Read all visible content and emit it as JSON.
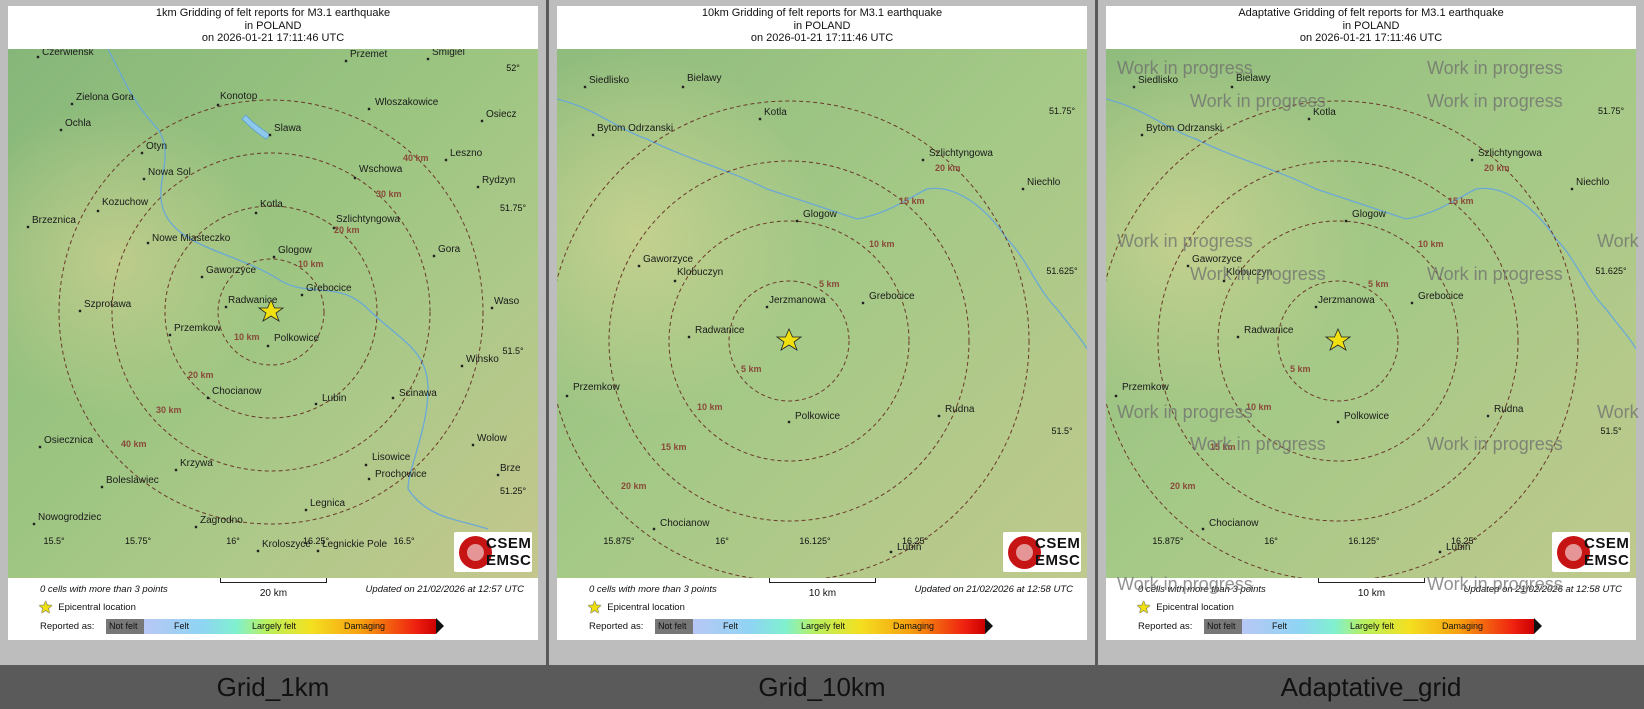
{
  "common": {
    "title_line1_prefix": "Gridding of felt reports for M3.1 earthquake",
    "title_line2": "in POLAND",
    "title_line3": "on  2026-01-21 17:11:46 UTC",
    "cells_note": "0 cells with more than 3 points",
    "epicentral_label": "Epicentral location",
    "reported_as": "Reported as:",
    "scale_labels": [
      "Not felt",
      "Felt",
      "Largely felt",
      "Damaging"
    ],
    "logo_line1": "CSEM",
    "logo_line2": "EMSC",
    "colors": {
      "not_felt": "#777777",
      "felt": "#8fd4f4",
      "largely_felt": "#f3e020",
      "damaging": "#ef2010",
      "epicenter": "#f0e010"
    }
  },
  "panels": [
    {
      "title_line1": "1km Gridding of felt reports for M3.1 earthquake",
      "updated": "Updated on 21/02/2026 at 12:57 UTC",
      "scale_label": "20 km",
      "caption": "Grid_1km",
      "watermark": "",
      "cities": [
        "Czerwiensk",
        "Przemet",
        "Smigiel",
        "Zielona Gora",
        "Konotop",
        "Wloszakowice",
        "Osiecz",
        "Ochla",
        "Slawa",
        "Otyn",
        "Leszno",
        "Nowa Sol",
        "Wschowa",
        "Rydzyn",
        "Kozuchow",
        "Kotla",
        "Brzeznica",
        "Szlichtyngowa",
        "Nowe Miasteczko",
        "Glogow",
        "Gora",
        "Gaworzyce",
        "Grebocice",
        "Szprotawa",
        "Radwanice",
        "Waso",
        "Przemkow",
        "Polkowice",
        "Winsko",
        "Chocianow",
        "Lubin",
        "Scinawa",
        "Osiecznica",
        "Wolow",
        "Krzywa",
        "Lisowice",
        "Boleslawiec",
        "Prochowice",
        "Brze",
        "Legnica",
        "Nowogrodziec",
        "Zagrodno",
        "Kroloszyce",
        "Legnickie Pole"
      ],
      "ring_labels": [
        "10 km",
        "10 km",
        "20 km",
        "20 km",
        "30 km",
        "30 km",
        "40 km",
        "40 km"
      ],
      "lat_labels": [
        "52°",
        "51.75°",
        "51.5°",
        "51.25°"
      ],
      "lon_labels": [
        "15.5°",
        "15.75°",
        "16°",
        "16.25°",
        "16.5°"
      ]
    },
    {
      "title_line1": "10km Gridding of felt reports for M3.1 earthquake",
      "updated": "Updated on 21/02/2026 at 12:58 UTC",
      "scale_label": "10 km",
      "caption": "Grid_10km",
      "watermark": "",
      "cities": [
        "Siedlisko",
        "Bielawy",
        "Kotla",
        "Bytom Odrzanski",
        "Szlichtyngowa",
        "Niechlo",
        "Glogow",
        "Gaworzyce",
        "Klobuczyn",
        "Grebocice",
        "Jerzmanowa",
        "Radwanice",
        "Przemkow",
        "Rudna",
        "Polkowice",
        "Chocianow",
        "Lubin"
      ],
      "ring_labels": [
        "5 km",
        "5 km",
        "10 km",
        "10 km",
        "15 km",
        "15 km",
        "20 km",
        "20 km"
      ],
      "lat_labels": [
        "51.75°",
        "51.625°",
        "51.5°"
      ],
      "lon_labels": [
        "15.875°",
        "16°",
        "16.125°",
        "16.25°"
      ]
    },
    {
      "title_line1": "Adaptative Gridding of felt reports for M3.1 earthquake",
      "updated": "Updated on 21/02/2026 at 12:58 UTC",
      "scale_label": "10 km",
      "caption": "Adaptative_grid",
      "watermark": "Work in progress",
      "cities": [
        "Siedlisko",
        "Bielawy",
        "Kotla",
        "Bytom Odrzanski",
        "Szlichtyngowa",
        "Niechlo",
        "Glogow",
        "Gaworzyce",
        "Klobuczyn",
        "Grebocice",
        "Jerzmanowa",
        "Radwanice",
        "Przemkow",
        "Rudna",
        "Polkowice",
        "Chocianow",
        "Lubin"
      ],
      "ring_labels": [
        "5 km",
        "5 km",
        "10 km",
        "10 km",
        "15 km",
        "15 km",
        "20 km",
        "20 km"
      ],
      "lat_labels": [
        "51.75°",
        "51.625°",
        "51.5°"
      ],
      "lon_labels": [
        "15.875°",
        "16°",
        "16.125°",
        "16.25°"
      ]
    }
  ]
}
